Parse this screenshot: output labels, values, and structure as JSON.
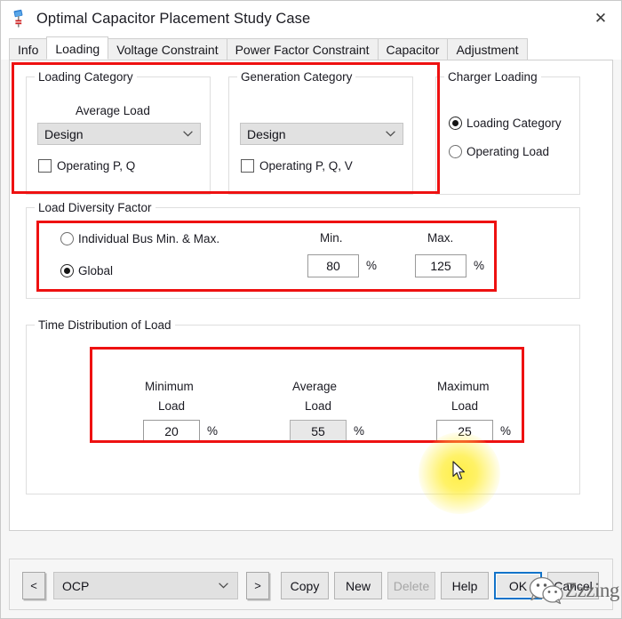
{
  "window": {
    "title": "Optimal Capacitor Placement Study Case",
    "icon": "capacitor-icon",
    "close_label": "✕"
  },
  "tabs": [
    {
      "label": "Info",
      "active": false
    },
    {
      "label": "Loading",
      "active": true
    },
    {
      "label": "Voltage Constraint",
      "active": false
    },
    {
      "label": "Power Factor Constraint",
      "active": false
    },
    {
      "label": "Capacitor",
      "active": false
    },
    {
      "label": "Adjustment",
      "active": false
    }
  ],
  "loading_category": {
    "title": "Loading Category",
    "field_label": "Average Load",
    "combo_value": "Design",
    "checkbox_label": "Operating P, Q",
    "checkbox_checked": false
  },
  "generation_category": {
    "title": "Generation Category",
    "combo_value": "Design",
    "checkbox_label": "Operating P, Q, V",
    "checkbox_checked": false
  },
  "charger_loading": {
    "title": "Charger Loading",
    "options": [
      {
        "label": "Loading Category",
        "selected": true
      },
      {
        "label": "Operating Load",
        "selected": false
      }
    ]
  },
  "load_diversity": {
    "title": "Load Diversity Factor",
    "options": [
      {
        "label": "Individual Bus Min. & Max.",
        "selected": false
      },
      {
        "label": "Global",
        "selected": true
      }
    ],
    "min_label": "Min.",
    "max_label": "Max.",
    "min_value": "80",
    "max_value": "125",
    "min_unit": "%",
    "max_unit": "%"
  },
  "time_distribution": {
    "title": "Time Distribution of Load",
    "columns": [
      {
        "label_line1": "Minimum",
        "label_line2": "Load",
        "value": "20",
        "unit": "%",
        "disabled": false
      },
      {
        "label_line1": "Average",
        "label_line2": "Load",
        "value": "55",
        "unit": "%",
        "disabled": true
      },
      {
        "label_line1": "Maximum",
        "label_line2": "Load",
        "value": "25",
        "unit": "%",
        "disabled": false
      }
    ]
  },
  "bottom_bar": {
    "prev_label": "<",
    "next_label": ">",
    "study_value": "OCP",
    "buttons": [
      {
        "label": "Copy",
        "state": "normal"
      },
      {
        "label": "New",
        "state": "normal"
      },
      {
        "label": "Delete",
        "state": "disabled"
      },
      {
        "label": "Help",
        "state": "normal"
      },
      {
        "label": "OK",
        "state": "focused"
      },
      {
        "label": "Cancel",
        "state": "normal"
      }
    ]
  },
  "watermark": {
    "text": "Zzzing"
  },
  "annotation_color": "#ee1111"
}
